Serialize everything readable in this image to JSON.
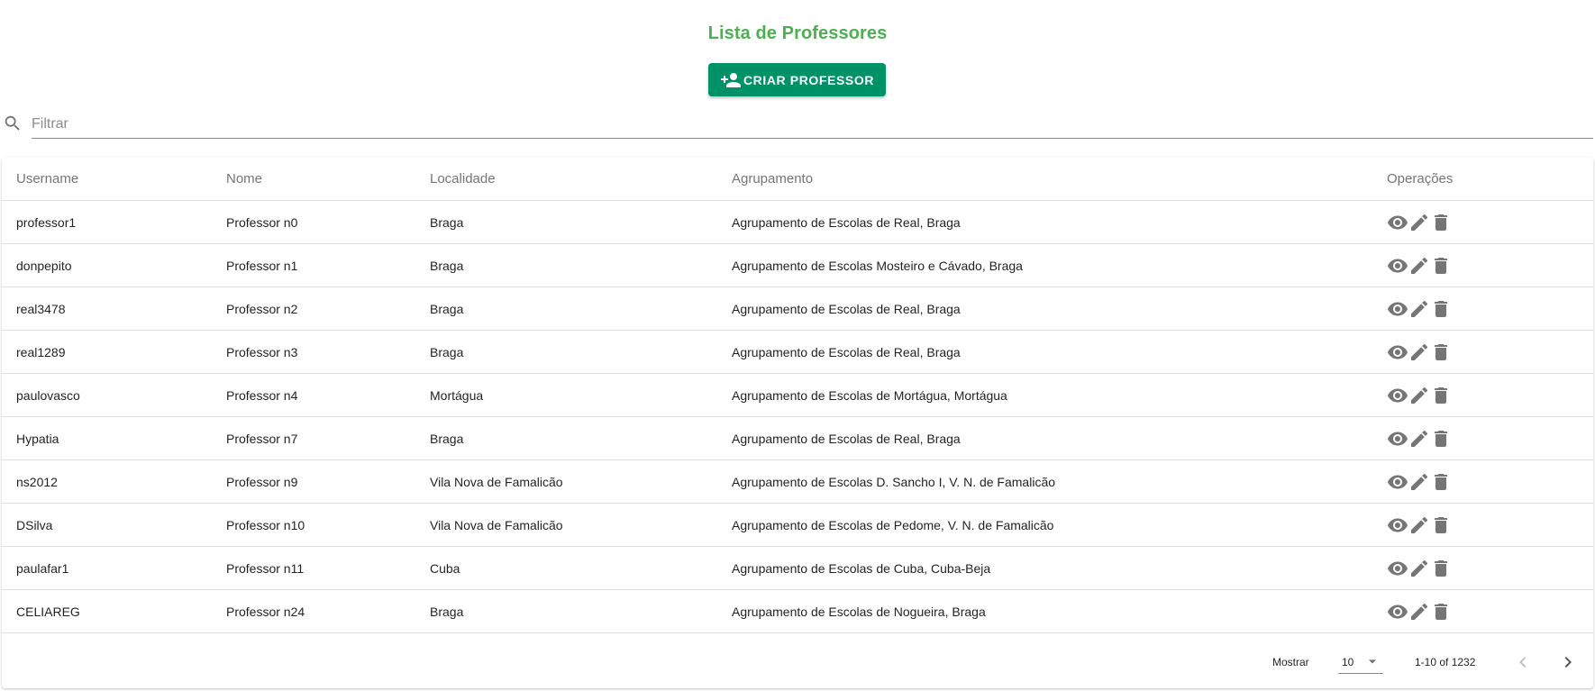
{
  "header": {
    "title": "Lista de Professores",
    "create_button_label": "CRIAR PROFESSOR",
    "create_button_icon": "person-add-icon"
  },
  "filter": {
    "placeholder": "Filtrar",
    "value": ""
  },
  "table": {
    "columns": [
      "Username",
      "Nome",
      "Localidade",
      "Agrupamento",
      "Operações"
    ],
    "rows": [
      {
        "username": "professor1",
        "nome": "Professor n0",
        "localidade": "Braga",
        "agrupamento": "Agrupamento de Escolas de Real, Braga"
      },
      {
        "username": "donpepito",
        "nome": "Professor n1",
        "localidade": "Braga",
        "agrupamento": "Agrupamento de Escolas Mosteiro e Cávado, Braga"
      },
      {
        "username": "real3478",
        "nome": "Professor n2",
        "localidade": "Braga",
        "agrupamento": "Agrupamento de Escolas de Real, Braga"
      },
      {
        "username": "real1289",
        "nome": "Professor n3",
        "localidade": "Braga",
        "agrupamento": "Agrupamento de Escolas de Real, Braga"
      },
      {
        "username": "paulovasco",
        "nome": "Professor n4",
        "localidade": "Mortágua",
        "agrupamento": "Agrupamento de Escolas de Mortágua, Mortágua"
      },
      {
        "username": "Hypatia",
        "nome": "Professor n7",
        "localidade": "Braga",
        "agrupamento": "Agrupamento de Escolas de Real, Braga"
      },
      {
        "username": "ns2012",
        "nome": "Professor n9",
        "localidade": "Vila Nova de Famalicão",
        "agrupamento": "Agrupamento de Escolas D. Sancho I, V. N. de Famalicão"
      },
      {
        "username": "DSilva",
        "nome": "Professor n10",
        "localidade": "Vila Nova de Famalicão",
        "agrupamento": "Agrupamento de Escolas de Pedome, V. N. de Famalicão"
      },
      {
        "username": "paulafar1",
        "nome": "Professor n11",
        "localidade": "Cuba",
        "agrupamento": "Agrupamento de Escolas de Cuba, Cuba-Beja"
      },
      {
        "username": "CELIAREG",
        "nome": "Professor n24",
        "localidade": "Braga",
        "agrupamento": "Agrupamento de Escolas de Nogueira, Braga"
      }
    ],
    "row_operations": [
      "view-icon",
      "edit-icon",
      "delete-icon"
    ]
  },
  "pagination": {
    "rows_label": "Mostrar",
    "rows_per_page": "10",
    "range_text": "1-10 of 1232"
  },
  "colors": {
    "title": "#4caf50",
    "primary_button": "#009167",
    "icon": "#757575"
  }
}
